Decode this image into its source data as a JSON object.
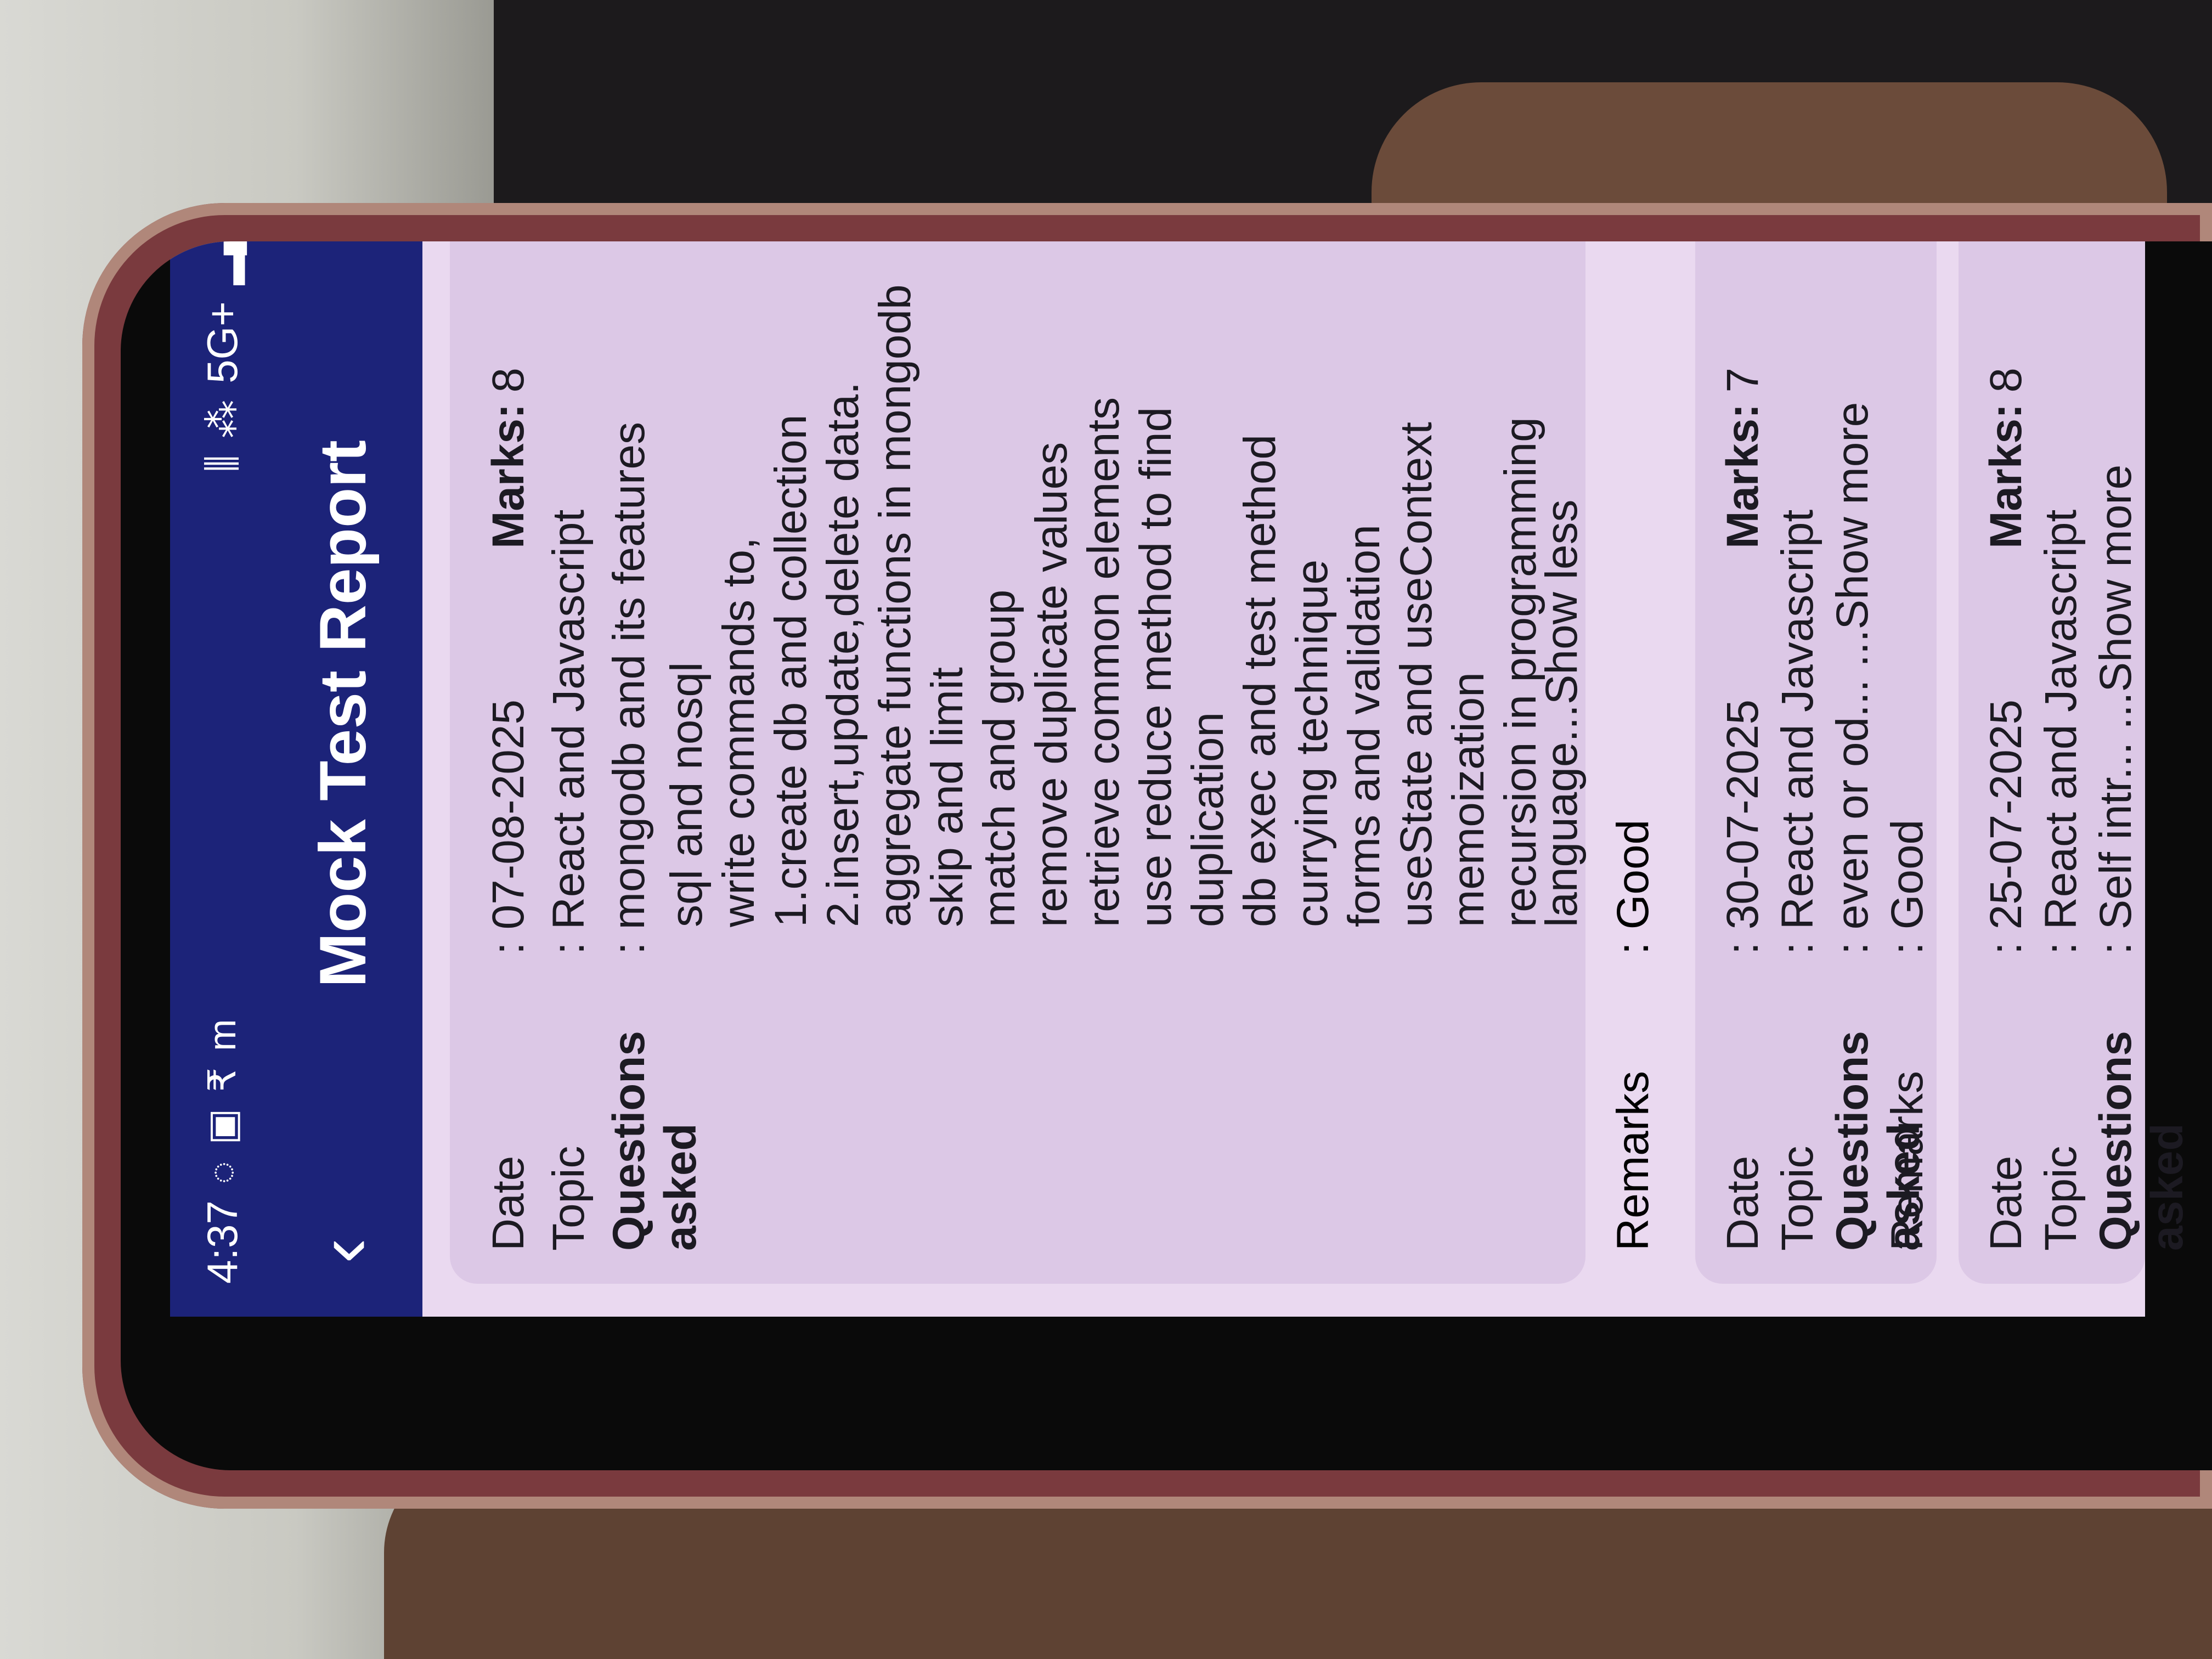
{
  "status_bar": {
    "time": "4:37",
    "left_icons": [
      "whatsapp-icon",
      "linkedin-icon",
      "rupee-icon",
      "m-icon"
    ],
    "network": "5G+",
    "right_icons": [
      "vibrate-icon",
      "volte-icon",
      "signal-icon",
      "battery-icon"
    ]
  },
  "app_bar": {
    "title": "Mock Test Report",
    "back_icon": "chevron-left-icon",
    "home_icon": "home-icon"
  },
  "labels": {
    "date": "Date",
    "topic": "Topic",
    "questions": "Questions asked",
    "remarks": "Remarks",
    "marks": "Marks:"
  },
  "reports": [
    {
      "date": ": 07-08-2025",
      "marks": "8",
      "topic": ":  React and Javascript",
      "questions_first": ": mongodb and its features",
      "questions_rest": [
        "sql and nosql",
        "write commands to,",
        "1.create db and collection",
        "2.insert,update,delete data.",
        "aggregate functions in mongodb",
        "skip and limit",
        "match and group",
        "remove duplicate values",
        "retrieve common elements",
        "use reduce method to find",
        "duplication",
        "db exec and test method",
        "currying technique",
        "forms and validation",
        "useState and useContext",
        "memoization",
        "recursion in programming",
        "language...Show less"
      ],
      "remarks": ": Good"
    },
    {
      "date": ": 30-07-2025",
      "marks": "7",
      "topic": ":  React and Javascript",
      "questions_first": ": even or od... ...Show more",
      "remarks": ": Good"
    },
    {
      "date": ": 25-07-2025",
      "marks": "8",
      "topic": ":  React and Javascript",
      "questions_first": ": Self intr... ...Show more"
    }
  ]
}
